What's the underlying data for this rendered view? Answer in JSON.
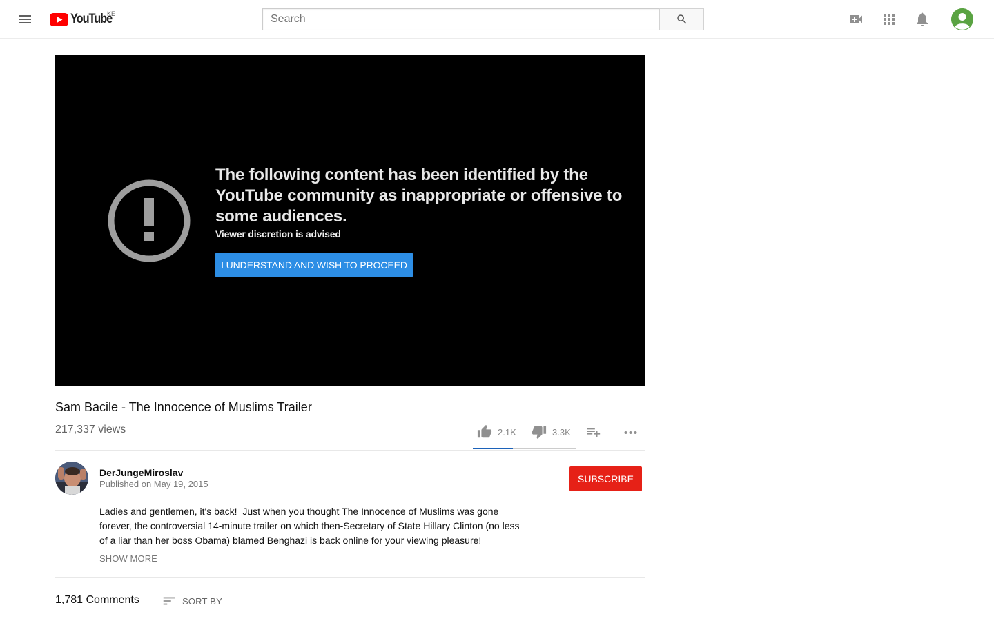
{
  "masthead": {
    "logo_text": "YouTube",
    "country_code": "KE",
    "search_placeholder": "Search",
    "icons": [
      "menu-icon",
      "search-icon",
      "upload-video-icon",
      "apps-grid-icon",
      "notifications-bell-icon",
      "account-avatar"
    ]
  },
  "player": {
    "warning_title": "The following content has been identified by the YouTube community as inappropriate or offensive to some audiences.",
    "warning_subtitle": "Viewer discretion is advised",
    "proceed_label": "I UNDERSTAND AND WISH TO PROCEED",
    "colors": {
      "background": "#000000",
      "button": "#2d8ee5",
      "icon": "#9e9e9e"
    }
  },
  "video": {
    "title": "Sam Bacile - The Innocence of Muslims Trailer",
    "views": "217,337 views",
    "likes": "2.1K",
    "dislikes": "3.3K",
    "like_ratio": 0.39
  },
  "channel": {
    "name": "DerJungeMiroslav",
    "published": "Published on May 19, 2015",
    "subscribe_label": "SUBSCRIBE",
    "subscribe_color": "#e62117"
  },
  "description": {
    "text": "Ladies and gentlemen, it's back!  Just when you thought The Innocence of Muslims was gone forever, the controversial 14-minute trailer on which then-Secretary of State Hillary Clinton (no less of a liar than her boss Obama) blamed Benghazi is back online for your viewing pleasure!",
    "show_more_label": "SHOW MORE"
  },
  "comments": {
    "count_label": "1,781 Comments",
    "sort_label": "SORT BY"
  }
}
